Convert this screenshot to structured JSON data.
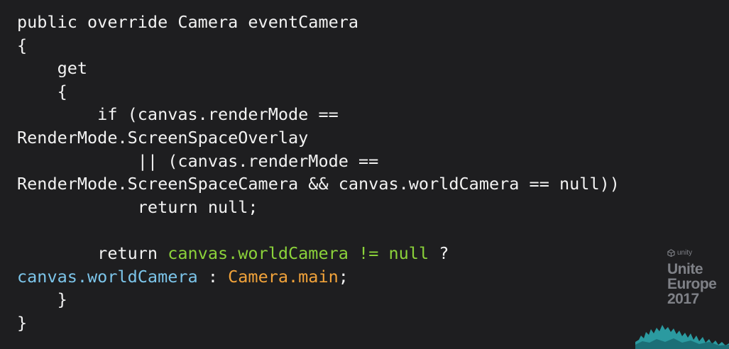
{
  "code": {
    "lines": [
      [
        {
          "text": "public override Camera eventCamera",
          "color": "plain"
        }
      ],
      [
        {
          "text": "{",
          "color": "plain"
        }
      ],
      [
        {
          "text": "    get",
          "color": "plain"
        }
      ],
      [
        {
          "text": "    {",
          "color": "plain"
        }
      ],
      [
        {
          "text": "        if (canvas.renderMode ==",
          "color": "plain"
        }
      ],
      [
        {
          "text": "RenderMode.ScreenSpaceOverlay",
          "color": "plain"
        }
      ],
      [
        {
          "text": "            || (canvas.renderMode ==",
          "color": "plain"
        }
      ],
      [
        {
          "text": "RenderMode.ScreenSpaceCamera && canvas.worldCamera == null))",
          "color": "plain"
        }
      ],
      [
        {
          "text": "            return null;",
          "color": "plain"
        }
      ],
      [
        {
          "text": "",
          "color": "plain"
        }
      ],
      [
        {
          "text": "        return ",
          "color": "plain"
        },
        {
          "text": "canvas.worldCamera != null",
          "color": "green"
        },
        {
          "text": " ?",
          "color": "plain"
        }
      ],
      [
        {
          "text": "canvas.worldCamera",
          "color": "blue"
        },
        {
          "text": " : ",
          "color": "plain"
        },
        {
          "text": "Camera.main",
          "color": "orange"
        },
        {
          "text": ";",
          "color": "plain"
        }
      ],
      [
        {
          "text": "    }",
          "color": "plain"
        }
      ],
      [
        {
          "text": "}",
          "color": "plain"
        }
      ]
    ]
  },
  "brand": {
    "small": "unity",
    "line1": "Unite",
    "line2": "Europe",
    "line3": "2017",
    "icon": "unity-cube-icon"
  },
  "colors": {
    "background": "#1e1e20",
    "plain": "#f2f2f2",
    "green": "#8bd23a",
    "blue": "#7cc5ea",
    "orange": "#f2a33a",
    "brand_gray": "#7f8187",
    "wave_teal": "#2b9aa0"
  }
}
